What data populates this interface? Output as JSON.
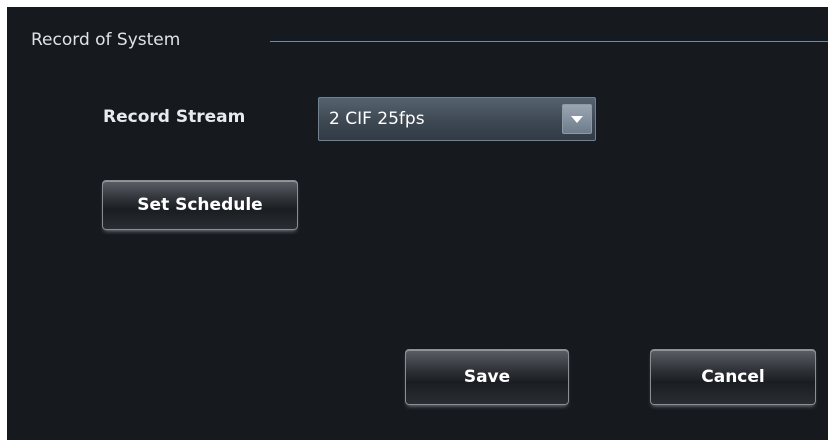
{
  "section": {
    "title": "Record of System"
  },
  "record_stream": {
    "label": "Record Stream",
    "selected_value": "2 CIF 25fps"
  },
  "buttons": {
    "set_schedule": "Set Schedule",
    "save": "Save",
    "cancel": "Cancel"
  },
  "colors": {
    "panel_background": "#161a1f",
    "page_background": "#ffffff",
    "section_rule": "#6f8aa8"
  },
  "icons": {
    "select_arrow": "chevron-down-icon"
  }
}
